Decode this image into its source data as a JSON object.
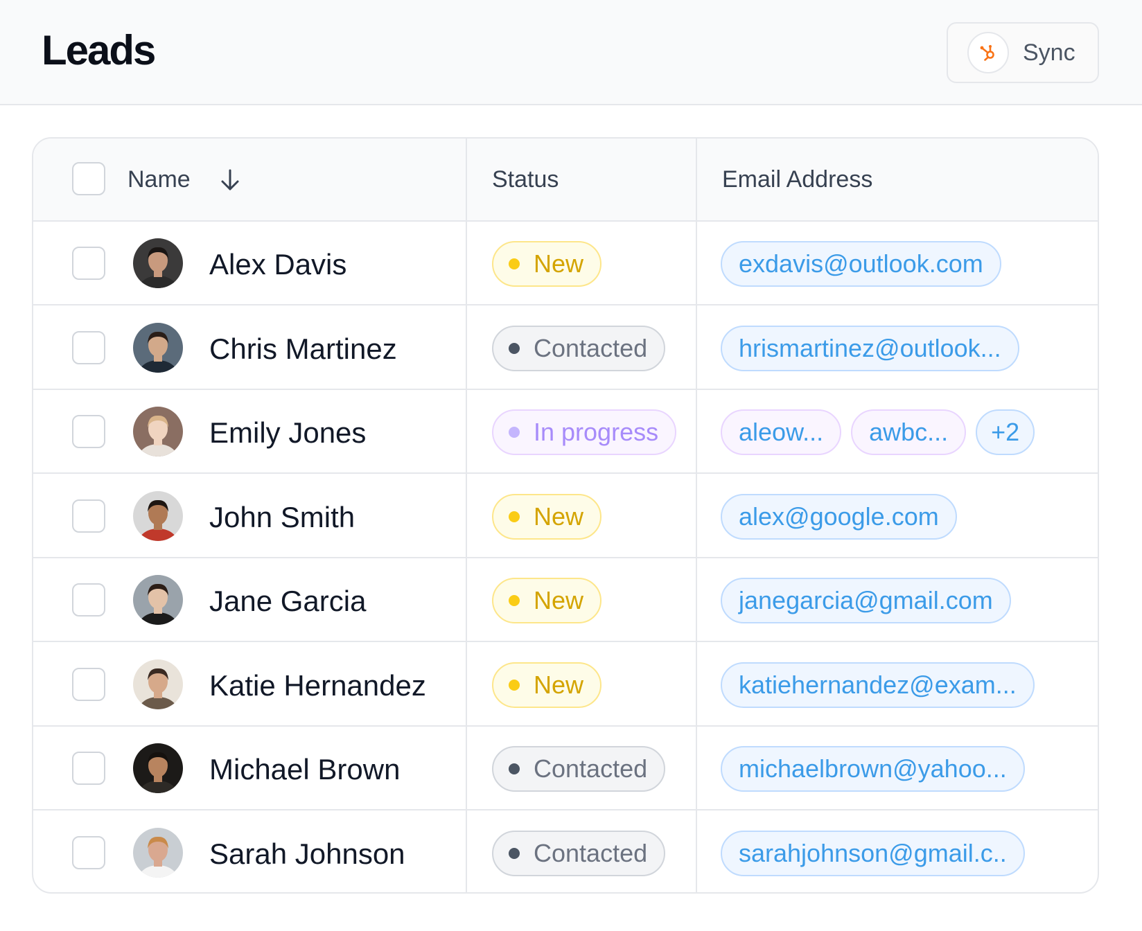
{
  "header": {
    "title": "Leads",
    "sync_label": "Sync",
    "sync_icon": "hubspot-icon",
    "accent": "#f97316"
  },
  "table": {
    "columns": {
      "name": "Name",
      "status": "Status",
      "email": "Email Address"
    },
    "sort": {
      "column": "name",
      "direction": "descending",
      "icon": "arrow-down-icon"
    },
    "rows": [
      {
        "name": "Alex Davis",
        "status": "New",
        "emails": [
          "exdavis@outlook.com"
        ],
        "more": ""
      },
      {
        "name": "Chris Martinez",
        "status": "Contacted",
        "emails": [
          "hrismartinez@outlook..."
        ],
        "more": ""
      },
      {
        "name": "Emily Jones",
        "status": "In progress",
        "emails": [
          "aleow...",
          "awbc..."
        ],
        "more": "+2"
      },
      {
        "name": "John Smith",
        "status": "New",
        "emails": [
          "alex@google.com"
        ],
        "more": ""
      },
      {
        "name": "Jane Garcia",
        "status": "New",
        "emails": [
          "janegarcia@gmail.com"
        ],
        "more": ""
      },
      {
        "name": "Katie Hernandez",
        "status": "New",
        "emails": [
          "katiehernandez@exam..."
        ],
        "more": ""
      },
      {
        "name": "Michael Brown",
        "status": "Contacted",
        "emails": [
          "michaelbrown@yahoo..."
        ],
        "more": ""
      },
      {
        "name": "Sarah Johnson",
        "status": "Contacted",
        "emails": [
          "sarahjohnson@gmail.c.."
        ],
        "more": ""
      }
    ]
  },
  "status_colors": {
    "New": "#facc15",
    "Contacted": "#4b5563",
    "In progress": "#c4b5fd"
  }
}
